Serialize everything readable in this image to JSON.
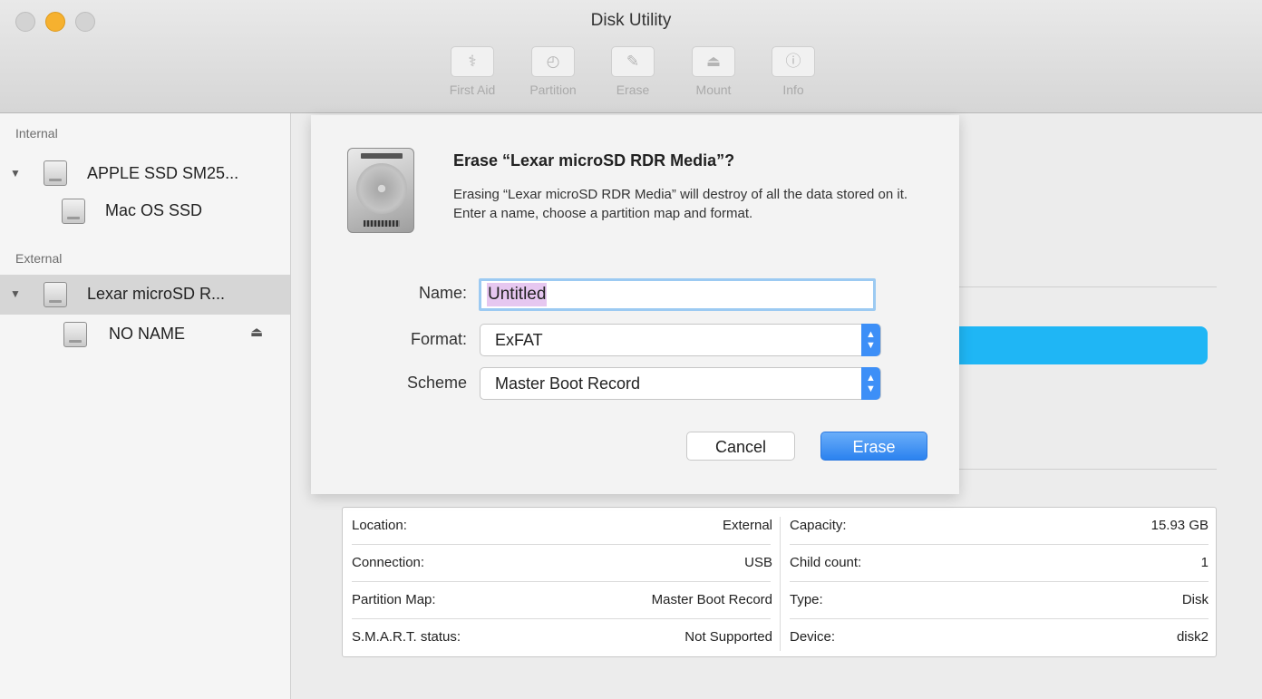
{
  "window": {
    "title": "Disk Utility"
  },
  "toolbar": [
    {
      "label": "First Aid",
      "icon": "stethoscope-icon",
      "glyph": "⚕"
    },
    {
      "label": "Partition",
      "icon": "partition-icon",
      "glyph": "◴"
    },
    {
      "label": "Erase",
      "icon": "erase-icon",
      "glyph": "✎"
    },
    {
      "label": "Mount",
      "icon": "mount-icon",
      "glyph": "⏏"
    },
    {
      "label": "Info",
      "icon": "info-icon",
      "glyph": "ⓘ"
    }
  ],
  "sidebar": {
    "internal_label": "Internal",
    "external_label": "External",
    "items": [
      {
        "label": "APPLE SSD SM25..."
      },
      {
        "label": "Mac OS SSD"
      },
      {
        "label": "Lexar microSD R..."
      },
      {
        "label": "NO NAME",
        "eject": "⏏"
      }
    ]
  },
  "info_table": {
    "left": [
      {
        "key": "Location:",
        "value": "External"
      },
      {
        "key": "Connection:",
        "value": "USB"
      },
      {
        "key": "Partition Map:",
        "value": "Master Boot Record"
      },
      {
        "key": "S.M.A.R.T. status:",
        "value": "Not Supported"
      }
    ],
    "right": [
      {
        "key": "Capacity:",
        "value": "15.93 GB"
      },
      {
        "key": "Child count:",
        "value": "1"
      },
      {
        "key": "Type:",
        "value": "Disk"
      },
      {
        "key": "Device:",
        "value": "disk2"
      }
    ]
  },
  "dialog": {
    "title": "Erase “Lexar microSD RDR Media”?",
    "description": "Erasing “Lexar microSD RDR Media” will destroy of all the data stored on it. Enter a name, choose a partition map and format.",
    "name_label": "Name:",
    "name_value": "Untitled",
    "format_label": "Format:",
    "format_value": "ExFAT",
    "scheme_label": "Scheme",
    "scheme_value": "Master Boot Record",
    "popup_arrows": "▲▼",
    "cancel_label": "Cancel",
    "erase_label": "Erase"
  },
  "colors": {
    "accent": "#2b82ef",
    "usage_bar": "#1fb6f5",
    "minimize": "#f6b12f"
  }
}
